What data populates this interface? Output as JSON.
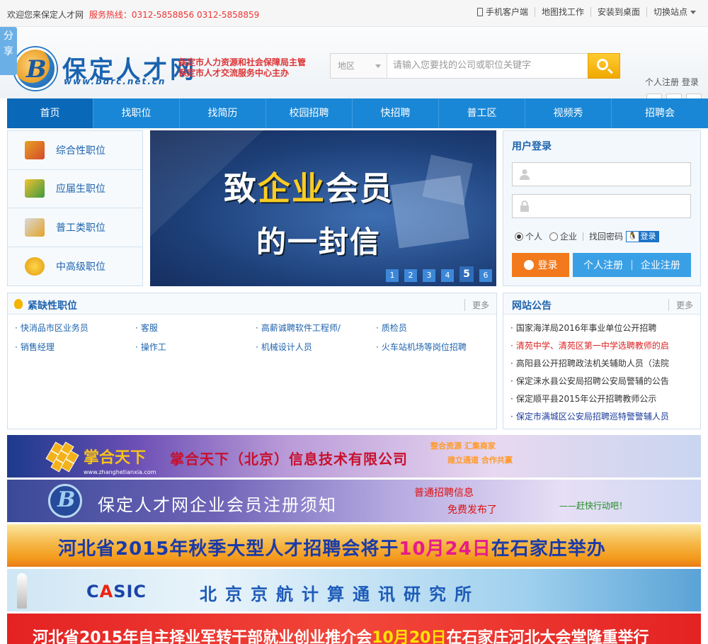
{
  "topbar": {
    "welcome": "欢迎您来保定人才网",
    "hotline_label": "服务热线：",
    "hotline_numbers": "0312-5858856  0312-5858859",
    "links": [
      "手机客户端",
      "地图找工作",
      "安装到桌面",
      "切换站点"
    ]
  },
  "share": {
    "label": "分享"
  },
  "header": {
    "logo_glyph": "B",
    "logo_text": "保定人才网",
    "logo_url": "www.bdrc.net.cn",
    "sub_line1": "保定市人力资源和社会保障局主管",
    "sub_line2": "保定市人才交流服务中心主办",
    "search_area": "地区",
    "search_placeholder": "请输入您要找的公司或职位关键字",
    "personal_register": "个人注册",
    "login": "登录"
  },
  "nav": [
    "首页",
    "找职位",
    "找简历",
    "校园招聘",
    "快招聘",
    "普工区",
    "视频秀",
    "招聘会"
  ],
  "categories": [
    {
      "label": "综合性职位",
      "icon": "tools-icon"
    },
    {
      "label": "应届生职位",
      "icon": "graduate-icon"
    },
    {
      "label": "普工类职位",
      "icon": "wrench-icon"
    },
    {
      "label": "中高级职位",
      "icon": "coins-icon"
    }
  ],
  "slider": {
    "line1_pre": "致",
    "line1_em": "企业",
    "line1_post": "会员",
    "line2": "的一封信",
    "dots": [
      "1",
      "2",
      "3",
      "4",
      "5",
      "6"
    ],
    "active": 5
  },
  "login": {
    "title": "用户登录",
    "radio_personal": "个人",
    "radio_company": "企业",
    "find_password": "找回密码",
    "qq_login": "登录",
    "login_button": "登录",
    "register_personal": "个人注册",
    "register_company": "企业注册",
    "register_sep": "|"
  },
  "urgent": {
    "title": "紧缺性职位",
    "more": "更多",
    "jobs": [
      "快消品市区业务员",
      "客服",
      "高薪诚聘软件工程师/",
      "质检员",
      "销售经理",
      "操作工",
      "机械设计人员",
      "火车站机场等岗位招聘"
    ]
  },
  "notices": {
    "title": "网站公告",
    "more": "更多",
    "items": [
      {
        "text": "国家海洋局2016年事业单位公开招聘",
        "style": "normal"
      },
      {
        "text": "清苑中学、清苑区第一中学选聘教师的启",
        "style": "red"
      },
      {
        "text": "高阳县公开招聘政法机关辅助人员（法院",
        "style": "normal"
      },
      {
        "text": "保定涞水县公安局招聘公安局警辅的公告",
        "style": "normal"
      },
      {
        "text": "保定顺平县2015年公开招聘教师公示",
        "style": "normal"
      },
      {
        "text": "保定市满城区公安局招聘巡特警警辅人员",
        "style": "blue"
      }
    ]
  },
  "ads": {
    "ad1_brand": "掌合天下",
    "ad1_url": "www.zhanghetianxia.com",
    "ad1_name": "掌合天下（北京）信息技术有限公司",
    "ad1_slogan1": "整合资源  汇集商家",
    "ad1_slogan2": "建立通道  合作共赢",
    "ad2_glyph": "B",
    "ad2_title": "保定人才网企业会员注册须知",
    "ad2_r1": "普通招聘信息",
    "ad2_r2": "免费发布了",
    "ad2_r3": "——赶快行动吧！",
    "ad3_pre": "河北省2015年秋季大型人才招聘会将于",
    "ad3_em": "10月24日",
    "ad3_post": "在石家庄举办",
    "ad4_logo_c": "C",
    "ad4_logo_a": "A",
    "ad4_logo_rest": "SIC",
    "ad4_title": "北京京航计算通讯研究所",
    "ad5_pre": "河北省2015年自主择业军转干部就业创业推介会",
    "ad5_em": "10月20日",
    "ad5_post": "在石家庄河北大会堂隆重举行"
  }
}
